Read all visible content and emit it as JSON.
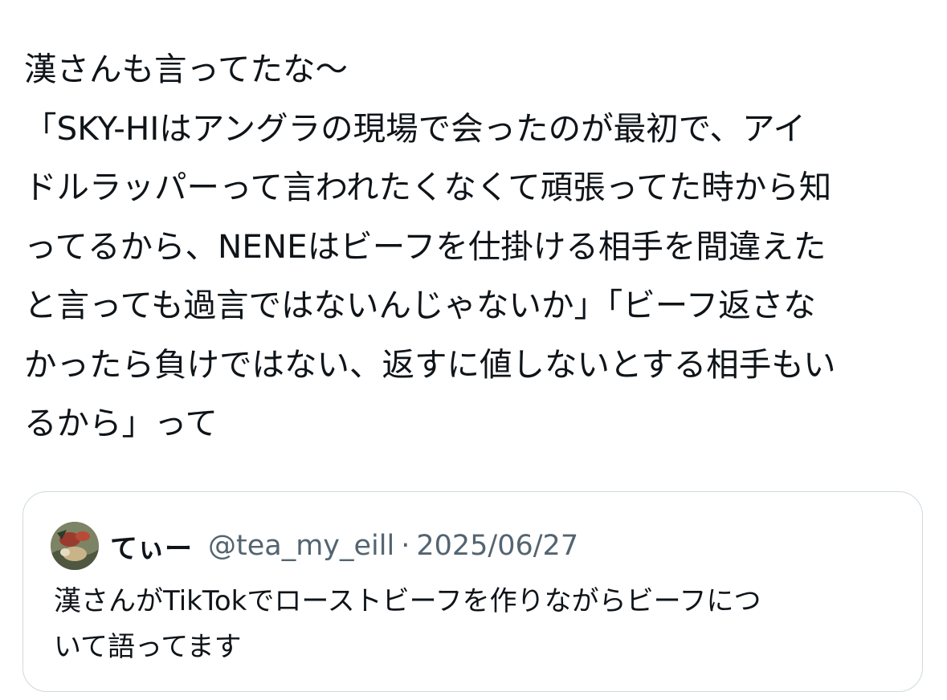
{
  "post": {
    "text_lines": [
      "漢さんも言ってたな〜",
      "「SKY-HIはアングラの現場で会ったのが最初で、アイ",
      "ドルラッパーって言われたくなくて頑張ってた時から知",
      "ってるから、NENEはビーフを仕掛ける相手を間違えた",
      "と言っても過言ではないんじゃないか」「ビーフ返さな",
      "かったら負けではない、返すに値しないとする相手もい",
      "るから」って"
    ]
  },
  "quote": {
    "avatar_icon": "profile-photo-avatar",
    "author_name": "てぃー",
    "author_handle": "@tea_my_eill",
    "separator": "·",
    "date": "2025/06/27",
    "text_lines": [
      "漢さんがTikTokでローストビーフを作りながらビーフにつ",
      "いて語ってます"
    ]
  },
  "colors": {
    "text_primary": "#0f1419",
    "text_secondary": "#536471",
    "card_border": "#cfd9de",
    "background": "#ffffff"
  }
}
